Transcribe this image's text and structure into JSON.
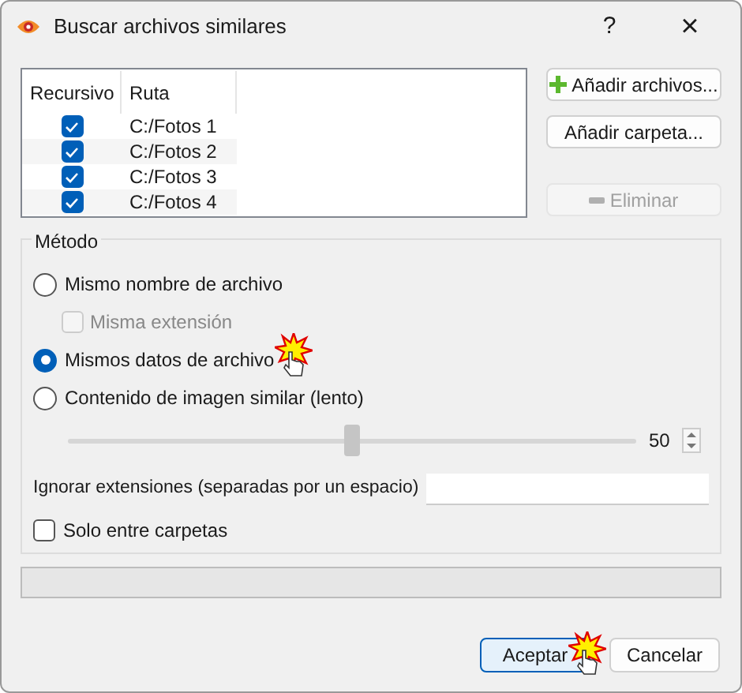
{
  "window": {
    "title": "Buscar archivos similares",
    "help": "?",
    "close": "×"
  },
  "table": {
    "columns": [
      "Recursivo",
      "Ruta"
    ],
    "rows": [
      {
        "checked": true,
        "path": "C:/Fotos 1"
      },
      {
        "checked": true,
        "path": "C:/Fotos 2"
      },
      {
        "checked": true,
        "path": "C:/Fotos 3"
      },
      {
        "checked": true,
        "path": "C:/Fotos 4"
      }
    ]
  },
  "side_buttons": [
    {
      "label": "Añadir archivos...",
      "kind": "add",
      "disabled": false
    },
    {
      "label": "Añadir carpeta...",
      "kind": "plain",
      "disabled": false
    },
    {
      "label": "Eliminar",
      "kind": "remove",
      "disabled": true
    }
  ],
  "method": {
    "title": "Método",
    "options": [
      {
        "label": "Mismo nombre de archivo",
        "selected": false,
        "sub": {
          "label": "Misma extensión",
          "checked": false,
          "disabled": true
        }
      },
      {
        "label": "Mismos datos de archivo",
        "selected": true,
        "clicked": true
      },
      {
        "label": "Contenido de imagen similar (lento)",
        "selected": false
      }
    ],
    "slider": {
      "level": 0.5,
      "value": "50"
    },
    "ignore": {
      "label": "Ignorar extensiones (separadas por un espacio)"
    },
    "only_folders": {
      "label": "Solo entre carpetas",
      "checked": false
    }
  },
  "buttons": [
    {
      "label": "Aceptar",
      "default": true,
      "clicked": true
    },
    {
      "label": "Cancelar",
      "default": false,
      "clicked": false
    }
  ]
}
